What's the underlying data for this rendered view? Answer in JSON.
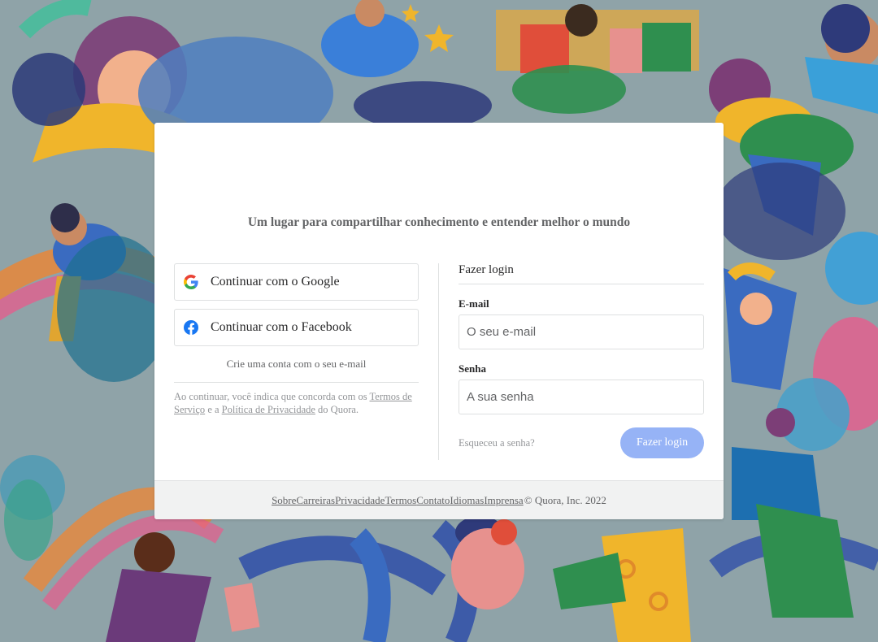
{
  "colors": {
    "page_background": "#8fa3a8",
    "card_background": "#ffffff",
    "footer_background": "#f1f2f2",
    "login_button": "#96b3f6",
    "text_dark": "#282829",
    "text_muted": "#636466",
    "text_light": "#939598",
    "border": "#dee0e1"
  },
  "background": {
    "illustration": "colorful illustrated people and rainbows"
  },
  "header": {
    "tagline": "Um lugar para compartilhar conhecimento e entender melhor o mundo"
  },
  "social": {
    "google": {
      "label": "Continuar com o Google",
      "icon": "google-icon"
    },
    "facebook": {
      "label": "Continuar com o Facebook",
      "icon": "facebook-icon"
    }
  },
  "signup": {
    "label": "Crie uma conta com o seu e-mail"
  },
  "terms": {
    "prefix": "Ao continuar, você indica que concorda com os ",
    "terms_link": "Termos de Serviço",
    "middle": " e a ",
    "privacy_link": "Política de Privacidade",
    "suffix": " do Quora."
  },
  "login": {
    "title": "Fazer login",
    "email_label": "E-mail",
    "email_placeholder": "O seu e-mail",
    "email_value": "",
    "password_label": "Senha",
    "password_placeholder": "A sua senha",
    "password_value": "",
    "forgot_label": "Esqueceu a senha?",
    "submit_label": "Fazer login"
  },
  "footer": {
    "links": [
      "Sobre",
      "Carreiras",
      "Privacidade",
      "Termos",
      "Contato",
      "Idiomas",
      "Imprensa"
    ],
    "copyright": "© Quora, Inc. 2022"
  }
}
